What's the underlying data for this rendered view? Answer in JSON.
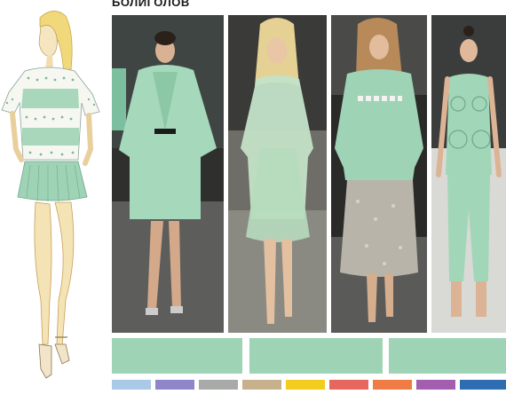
{
  "title": "БОЛИГОЛОВ",
  "sketch": {
    "icon": "fashion-sketch-illustration"
  },
  "photos": [
    {
      "icon": "runway-photo-coat",
      "mint": "#a6d8bc"
    },
    {
      "icon": "runway-photo-sheer-dress",
      "mint": "#c3e3c8"
    },
    {
      "icon": "runway-photo-sweatshirt",
      "mint": "#9ed3b5"
    },
    {
      "icon": "runway-photo-circle-top",
      "mint": "#a2d6b9"
    }
  ],
  "palette": {
    "main": [
      "#9fd3b6",
      "#9fd3b6",
      "#9fd3b6"
    ],
    "accents": [
      "#a9c9e6",
      "#8e86c8",
      "#a7aaa7",
      "#c7b08c",
      "#f2cc1e",
      "#e6675e",
      "#ef7c45",
      "#a35eb0",
      "#2f6db3"
    ]
  }
}
